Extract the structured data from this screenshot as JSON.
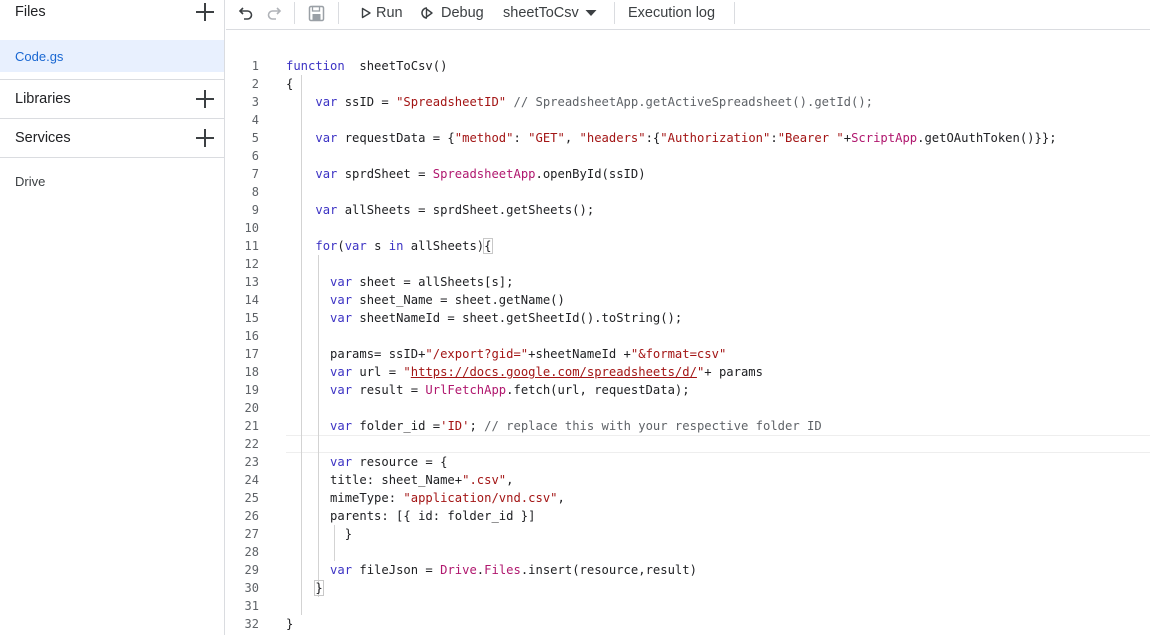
{
  "sidebar": {
    "files_title": "Files",
    "active_file": "Code.gs",
    "libraries_title": "Libraries",
    "services_title": "Services",
    "service_item": "Drive"
  },
  "toolbar": {
    "run_label": "Run",
    "debug_label": "Debug",
    "function_select": "sheetToCsv",
    "execution_log_label": "Execution log"
  },
  "editor": {
    "line_numbers": [
      "1",
      "2",
      "3",
      "4",
      "5",
      "6",
      "7",
      "8",
      "9",
      "10",
      "11",
      "12",
      "13",
      "14",
      "15",
      "16",
      "17",
      "18",
      "19",
      "20",
      "21",
      "22",
      "23",
      "24",
      "25",
      "26",
      "27",
      "28",
      "29",
      "30",
      "31",
      "32"
    ],
    "lines": [
      [
        [
          "kw",
          "function"
        ],
        [
          "",
          "  sheetToCsv()"
        ]
      ],
      [
        [
          "",
          "{"
        ]
      ],
      [
        [
          "",
          "    "
        ],
        [
          "kw",
          "var"
        ],
        [
          "",
          " ssID = "
        ],
        [
          "str",
          "\"SpreadsheetID\""
        ],
        [
          "cm",
          " // SpreadsheetApp.getActiveSpreadsheet().getId();"
        ]
      ],
      [],
      [
        [
          "",
          "    "
        ],
        [
          "kw",
          "var"
        ],
        [
          "",
          " requestData = {"
        ],
        [
          "str",
          "\"method\""
        ],
        [
          "",
          ": "
        ],
        [
          "str",
          "\"GET\""
        ],
        [
          "",
          ", "
        ],
        [
          "str",
          "\"headers\""
        ],
        [
          "",
          ":{"
        ],
        [
          "str",
          "\"Authorization\""
        ],
        [
          "",
          ":"
        ],
        [
          "str",
          "\"Bearer \""
        ],
        [
          "",
          "+"
        ],
        [
          "cls",
          "ScriptApp"
        ],
        [
          "",
          ".getOAuthToken()}};"
        ]
      ],
      [],
      [
        [
          "",
          "    "
        ],
        [
          "kw",
          "var"
        ],
        [
          "",
          " sprdSheet = "
        ],
        [
          "cls",
          "SpreadsheetApp"
        ],
        [
          "",
          ".openById(ssID)"
        ]
      ],
      [],
      [
        [
          "",
          "    "
        ],
        [
          "kw",
          "var"
        ],
        [
          "",
          " allSheets = sprdSheet.getSheets();"
        ]
      ],
      [],
      [
        [
          "",
          "    "
        ],
        [
          "kw",
          "for"
        ],
        [
          "",
          "("
        ],
        [
          "kw",
          "var"
        ],
        [
          "",
          " s "
        ],
        [
          "kw",
          "in"
        ],
        [
          "",
          " allSheets)"
        ],
        [
          "br",
          "{"
        ]
      ],
      [],
      [
        [
          "",
          "      "
        ],
        [
          "kw",
          "var"
        ],
        [
          "",
          " sheet = allSheets[s];"
        ]
      ],
      [
        [
          "",
          "      "
        ],
        [
          "kw",
          "var"
        ],
        [
          "",
          " sheet_Name = sheet.getName()"
        ]
      ],
      [
        [
          "",
          "      "
        ],
        [
          "kw",
          "var"
        ],
        [
          "",
          " sheetNameId = sheet.getSheetId().toString();"
        ]
      ],
      [],
      [
        [
          "",
          "      params= ssID+"
        ],
        [
          "str",
          "\"/export?gid=\""
        ],
        [
          "",
          "+sheetNameId +"
        ],
        [
          "str",
          "\"&format=csv\""
        ]
      ],
      [
        [
          "",
          "      "
        ],
        [
          "kw",
          "var"
        ],
        [
          "",
          " url = "
        ],
        [
          "str",
          "\""
        ],
        [
          "url",
          "https://docs.google.com/spreadsheets/d/"
        ],
        [
          "str",
          "\""
        ],
        [
          "",
          "+ params"
        ]
      ],
      [
        [
          "",
          "      "
        ],
        [
          "kw",
          "var"
        ],
        [
          "",
          " result = "
        ],
        [
          "cls",
          "UrlFetchApp"
        ],
        [
          "",
          ".fetch(url, requestData);"
        ]
      ],
      [],
      [
        [
          "",
          "      "
        ],
        [
          "kw",
          "var"
        ],
        [
          "",
          " folder_id ="
        ],
        [
          "str",
          "'ID'"
        ],
        [
          "",
          "; "
        ],
        [
          "cm",
          "// replace this with your respective folder ID"
        ]
      ],
      [],
      [
        [
          "",
          "      "
        ],
        [
          "kw",
          "var"
        ],
        [
          "",
          " resource = {"
        ]
      ],
      [
        [
          "",
          "      title: sheet_Name+"
        ],
        [
          "str",
          "\".csv\""
        ],
        [
          "",
          ","
        ]
      ],
      [
        [
          "",
          "      mimeType: "
        ],
        [
          "str",
          "\"application/vnd.csv\""
        ],
        [
          "",
          ","
        ]
      ],
      [
        [
          "",
          "      parents: [{ id: folder_id }]"
        ]
      ],
      [
        [
          "",
          "        }"
        ]
      ],
      [],
      [
        [
          "",
          "      "
        ],
        [
          "kw",
          "var"
        ],
        [
          "",
          " fileJson = "
        ],
        [
          "cls",
          "Drive"
        ],
        [
          "",
          "."
        ],
        [
          "cls",
          "Files"
        ],
        [
          "",
          ".insert(resource,result)"
        ]
      ],
      [
        [
          "",
          "    "
        ],
        [
          "br",
          "}"
        ]
      ],
      [],
      [
        [
          "",
          "}"
        ]
      ]
    ]
  }
}
